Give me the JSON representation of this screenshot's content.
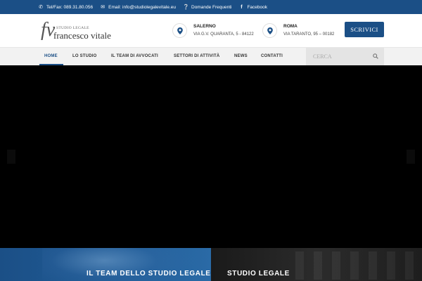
{
  "topbar": {
    "phone": "Tel/Fax: 089.31.80.056",
    "email": "Email: info@studiolegalevitale.eu",
    "faq": "Domande Frequenti",
    "facebook": "Facebook"
  },
  "logo": {
    "monogram": "fv",
    "subtitle": "STUDIO LEGALE",
    "name": "francesco vitale"
  },
  "locations": [
    {
      "city": "SALERNO",
      "address": "VIA G.V. QUARANTA, 5 - 84122"
    },
    {
      "city": "ROMA",
      "address": "VIA TARANTO, 95 – 00182"
    }
  ],
  "cta": {
    "label": "SCRIVICI"
  },
  "nav": {
    "items": [
      {
        "label": "HOME"
      },
      {
        "label": "LO STUDIO"
      },
      {
        "label": "IL TEAM DI AVVOCATI"
      },
      {
        "label": "SETTORI DI ATTIVITÀ"
      },
      {
        "label": "NEWS"
      },
      {
        "label": "CONTATTI"
      }
    ],
    "search_placeholder": "CERCA"
  },
  "panels": [
    {
      "title": "IL TEAM DELLO STUDIO LEGALE"
    },
    {
      "title": "STUDIO LEGALE"
    }
  ],
  "colors": {
    "primary": "#1b4f86",
    "nav_bg": "#f2f2f2",
    "hero_bg": "#000000"
  }
}
